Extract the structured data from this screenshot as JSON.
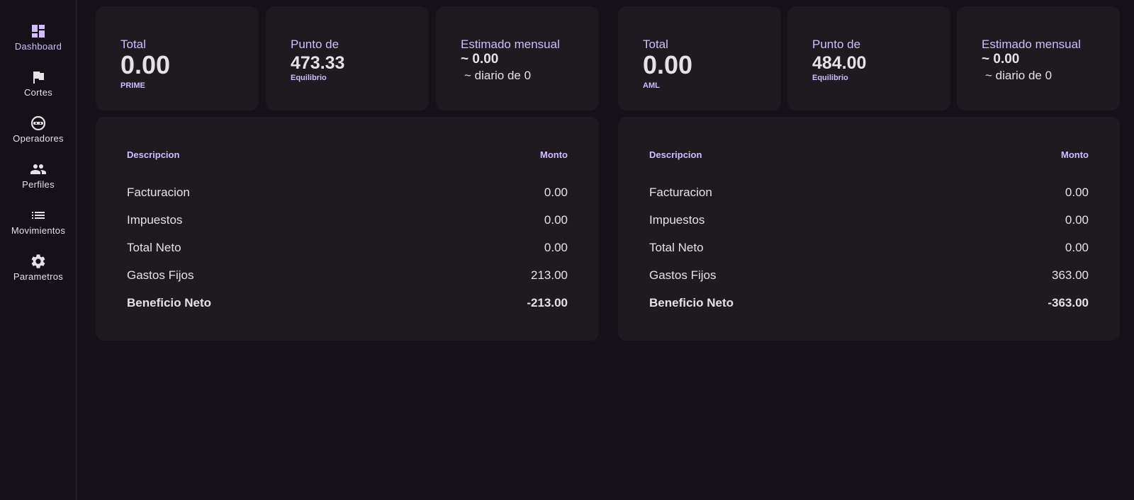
{
  "nav": [
    {
      "label": "Dashboard",
      "icon": "dashboard-icon"
    },
    {
      "label": "Cortes",
      "icon": "flag-icon"
    },
    {
      "label": "Operadores",
      "icon": "face-icon"
    },
    {
      "label": "Perfiles",
      "icon": "people-icon"
    },
    {
      "label": "Movimientos",
      "icon": "list-icon"
    },
    {
      "label": "Parametros",
      "icon": "gear-icon"
    }
  ],
  "accent": "#d0bcff",
  "panels": [
    {
      "total": {
        "label": "Total",
        "value": "0.00",
        "sub": "PRIME"
      },
      "breakeven": {
        "label": "Punto de",
        "value": "473.33",
        "sub": "Equilibrio"
      },
      "estimate": {
        "label": "Estimado mensual",
        "value": "~ 0.00",
        "daily": "~ diario de 0"
      },
      "table": {
        "col_desc": "Descripcion",
        "col_amount": "Monto",
        "rows": [
          {
            "desc": "Facturacion",
            "amount": "0.00"
          },
          {
            "desc": "Impuestos",
            "amount": "0.00"
          },
          {
            "desc": "Total Neto",
            "amount": "0.00"
          },
          {
            "desc": "Gastos Fijos",
            "amount": "213.00"
          },
          {
            "desc": "Beneficio Neto",
            "amount": "-213.00"
          }
        ]
      }
    },
    {
      "total": {
        "label": "Total",
        "value": "0.00",
        "sub": "AML"
      },
      "breakeven": {
        "label": "Punto de",
        "value": "484.00",
        "sub": "Equilibrio"
      },
      "estimate": {
        "label": "Estimado mensual",
        "value": "~ 0.00",
        "daily": "~ diario de 0"
      },
      "table": {
        "col_desc": "Descripcion",
        "col_amount": "Monto",
        "rows": [
          {
            "desc": "Facturacion",
            "amount": "0.00"
          },
          {
            "desc": "Impuestos",
            "amount": "0.00"
          },
          {
            "desc": "Total Neto",
            "amount": "0.00"
          },
          {
            "desc": "Gastos Fijos",
            "amount": "363.00"
          },
          {
            "desc": "Beneficio Neto",
            "amount": "-363.00"
          }
        ]
      }
    }
  ]
}
